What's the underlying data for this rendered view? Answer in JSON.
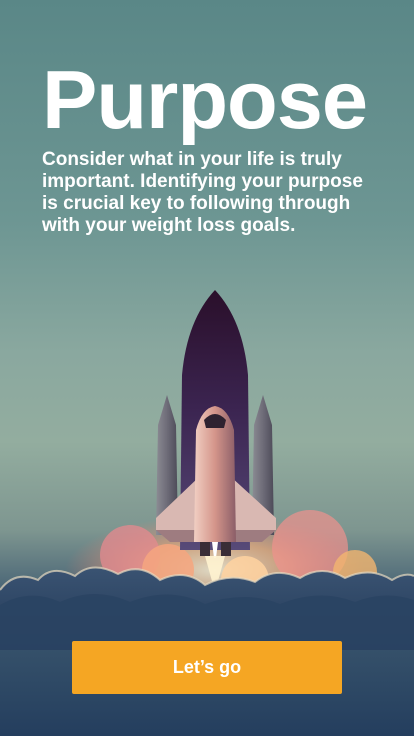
{
  "onboarding": {
    "title": "Purpose",
    "body": "Consider what in your life is truly important. Identifying your purpose is crucial key to following through with your weight loss goals.",
    "cta_label": "Let’s go"
  },
  "illustration": {
    "icon": "rocket-launch-icon"
  },
  "colors": {
    "accent": "#f5a623",
    "background_top": "#5a8787",
    "background_bottom": "#243e5e",
    "text": "#ffffff"
  }
}
